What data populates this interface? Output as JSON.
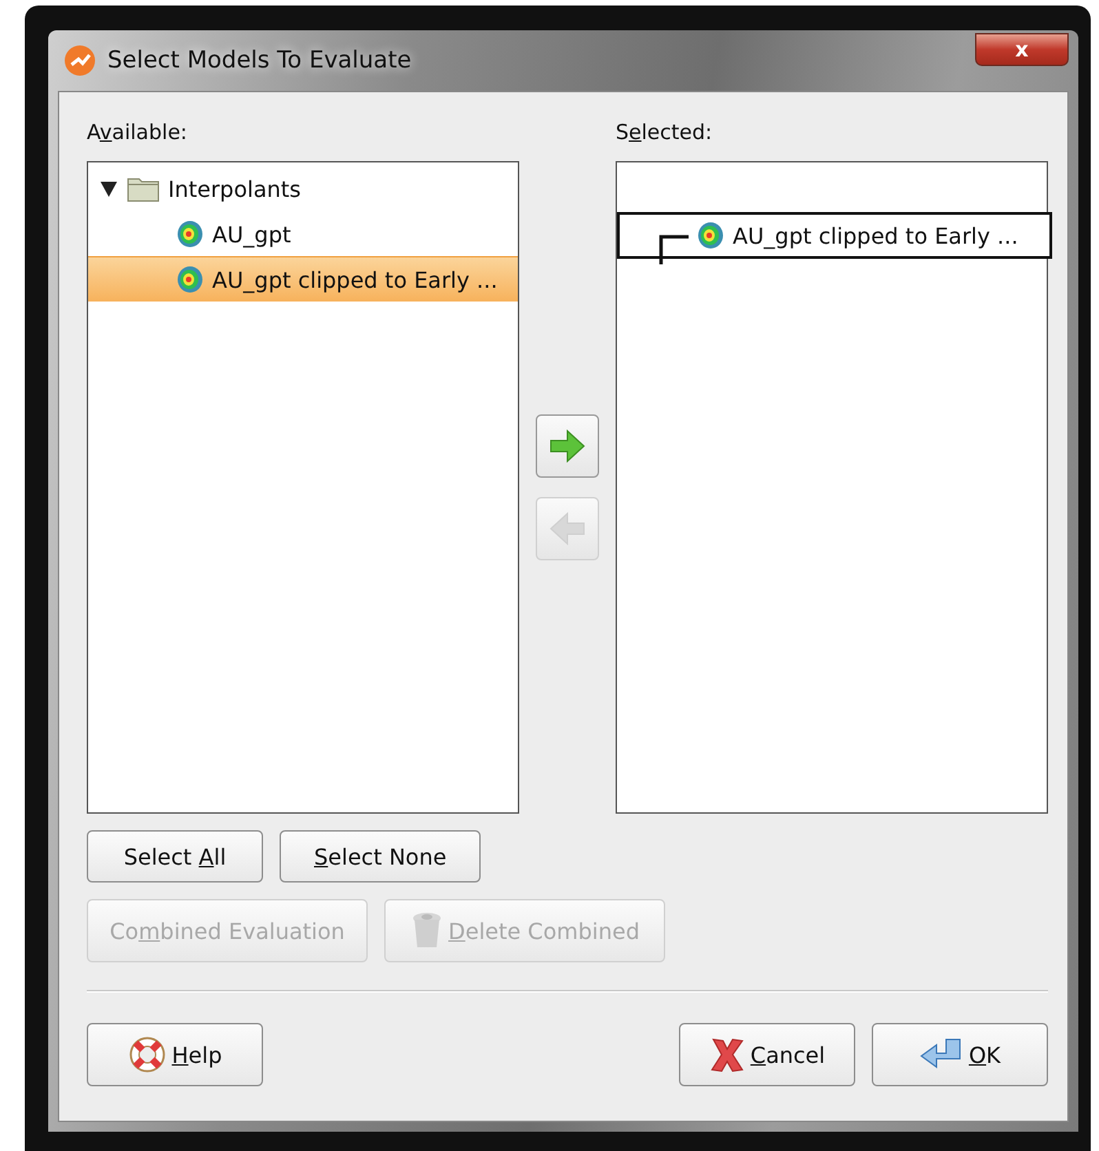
{
  "window": {
    "title": "Select Models To Evaluate",
    "close_label": "x"
  },
  "available": {
    "label": {
      "before": "A",
      "key": "v",
      "after": "ailable:"
    },
    "tree": [
      {
        "label": "Interpolants",
        "kind": "folder",
        "expanded": true,
        "selected": false,
        "children": [
          {
            "label": "AU_gpt",
            "kind": "model",
            "selected": false
          },
          {
            "label": "AU_gpt clipped to Early ...",
            "kind": "model",
            "selected": true
          }
        ]
      }
    ]
  },
  "selected": {
    "label": {
      "before": "S",
      "key": "e",
      "after": "lected:"
    },
    "items": [
      {
        "label": "AU_gpt clipped to Early ...",
        "kind": "model",
        "dragging": true
      }
    ]
  },
  "move_buttons": [
    {
      "disabled": false
    },
    {
      "disabled": true
    }
  ],
  "selection_buttons": [
    {
      "label": {
        "before": "Select ",
        "key": "A",
        "after": "ll"
      },
      "disabled": false
    },
    {
      "label": {
        "key": "S",
        "after": "elect None"
      },
      "disabled": false
    }
  ],
  "combined_buttons": [
    {
      "label": {
        "before": "Co",
        "key": "m",
        "after": "bined Evaluation"
      },
      "disabled": true
    },
    {
      "label": {
        "key": "D",
        "after": "elete Combined"
      },
      "disabled": true
    }
  ],
  "footer_buttons": [
    {
      "label": {
        "key": "H",
        "after": "elp"
      },
      "disabled": false
    },
    {
      "label": {
        "key": "C",
        "after": "ancel"
      },
      "disabled": false
    },
    {
      "label": {
        "key": "O",
        "after": "K"
      },
      "disabled": false
    }
  ]
}
